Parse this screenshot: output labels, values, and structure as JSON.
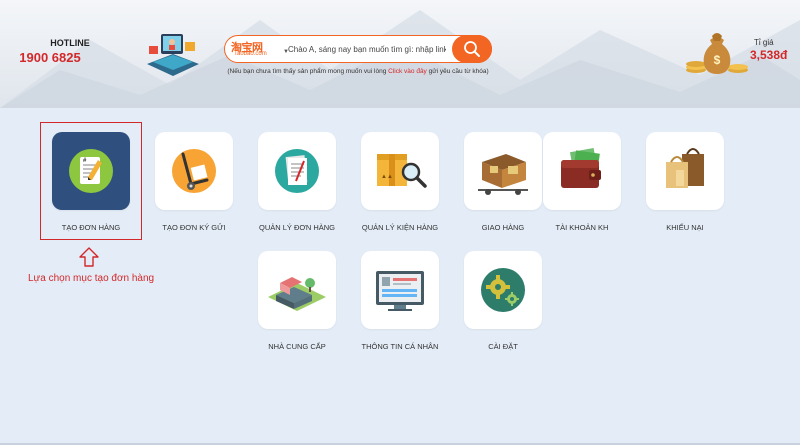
{
  "header": {
    "hotline_label": "HOTLINE",
    "hotline_number": "1900 6825",
    "search": {
      "site_name": "淘宝网",
      "site_domain": "Taobao.com",
      "placeholder": "Chào A, sáng nay bạn muốn tìm gì: nhập link"
    },
    "hint_prefix": "(Nếu bạn chưa tìm thấy sản phẩm mong muốn vui lòng ",
    "hint_link": "Click vào đây",
    "hint_suffix": " gửi yêu cầu từ khóa)",
    "exchange_label": "Tỉ giá",
    "exchange_value": "3,538đ"
  },
  "tiles": [
    {
      "label": "TẠO ĐƠN HÀNG",
      "icon": "notepad-icon"
    },
    {
      "label": "TẠO ĐƠN KÝ GỬI",
      "icon": "hand-truck-icon"
    },
    {
      "label": "QUẢN LÝ ĐƠN HÀNG",
      "icon": "document-icon"
    },
    {
      "label": "QUẢN LÝ KIỆN HÀNG",
      "icon": "package-search-icon"
    },
    {
      "label": "GIAO HÀNG",
      "icon": "delivery-cart-icon"
    },
    {
      "label": "TÀI KHOẢN KH",
      "icon": "wallet-icon"
    },
    {
      "label": "KHIẾU NẠI",
      "icon": "shopping-bags-icon"
    },
    {
      "label": "NHÀ CUNG CẤP",
      "icon": "supplier-building-icon"
    },
    {
      "label": "THÔNG TIN CÁ NHÂN",
      "icon": "profile-screen-icon"
    },
    {
      "label": "CÀI ĐẶT",
      "icon": "gears-icon"
    }
  ],
  "annotation": {
    "caption": "Lựa chọn mục tạo đơn hàng"
  },
  "colors": {
    "accent": "#f26522",
    "highlight": "#d2282a",
    "background": "#e4edf7"
  }
}
